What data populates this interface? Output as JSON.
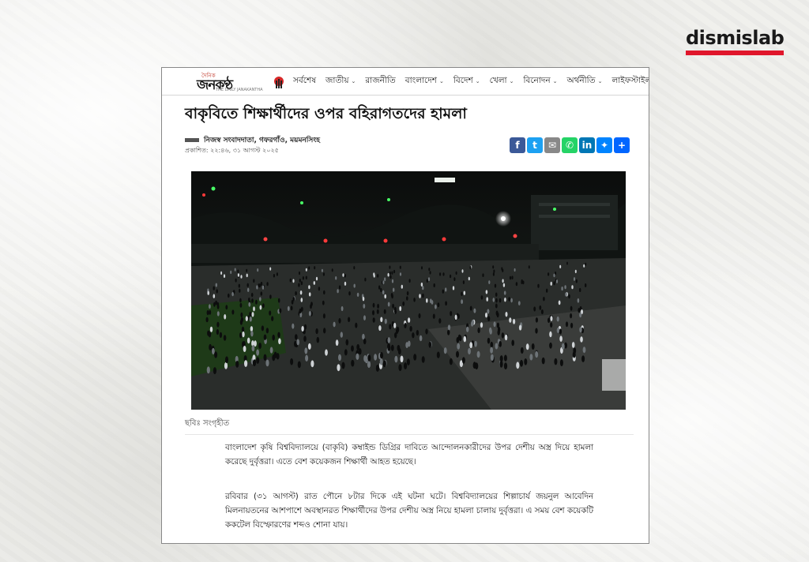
{
  "watermark": {
    "brand": "dismislab",
    "accent_color": "#e0162b"
  },
  "site": {
    "logo": {
      "small": "দৈনিক",
      "main": "জনকণ্ঠ",
      "sub": "THE DAILY JANAKANTHA"
    },
    "nav": [
      {
        "label": "সর্বশেষ",
        "has_dropdown": false
      },
      {
        "label": "জাতীয়",
        "has_dropdown": true
      },
      {
        "label": "রাজনীতি",
        "has_dropdown": false
      },
      {
        "label": "বাংলাদেশ",
        "has_dropdown": true
      },
      {
        "label": "বিদেশ",
        "has_dropdown": true
      },
      {
        "label": "খেলা",
        "has_dropdown": true
      },
      {
        "label": "বিনোদন",
        "has_dropdown": true
      },
      {
        "label": "অর্থনীতি",
        "has_dropdown": true
      },
      {
        "label": "লাইফস্টাইল",
        "has_dropdown": false
      }
    ]
  },
  "article": {
    "headline": "বাকৃবিতে শিক্ষার্থীদের ওপর বহিরাগতদের হামলা",
    "byline": "নিজস্ব সংবাদদাতা, গফরগাঁও, ময়মনসিংহ",
    "published": "প্রকাশিত: ২২:৪৬, ৩১ আগস্ট ২০২৫",
    "share_buttons": [
      {
        "icon": "facebook-icon",
        "glyph": "f",
        "color": "#3b5998"
      },
      {
        "icon": "twitter-icon",
        "glyph": "t",
        "color": "#1da1f2"
      },
      {
        "icon": "email-icon",
        "glyph": "✉",
        "color": "#888888"
      },
      {
        "icon": "whatsapp-icon",
        "glyph": "✆",
        "color": "#25d366"
      },
      {
        "icon": "linkedin-icon",
        "glyph": "in",
        "color": "#0077b5"
      },
      {
        "icon": "messenger-icon",
        "glyph": "✦",
        "color": "#0084ff"
      },
      {
        "icon": "share-plus-icon",
        "glyph": "+",
        "color": "#0166ff"
      }
    ],
    "caption": "ছবিঃ সংগৃহীত",
    "paragraphs": [
      "বাংলাদেশ কৃষি বিশ্ববিদ্যালয়ে (বাকৃবি) কম্বাইন্ড ডিগ্রির দাবিতে আন্দোলনকারীদের উপর দেশীয় অস্ত্র দিয়ে হামলা করেছে দুর্বৃত্তরা। এতে বেশ কয়েকজন শিক্ষার্থী আহত হয়েছে।",
      "রবিবার (৩১ আগস্ট) রাত পৌনে ৮টার দিকে এই ঘটনা ঘটে। বিশ্ববিদ্যালয়ের শিল্পাচার্য জয়নুল আবেদিন মিলনায়তনের আশপাশে অবস্থানরত শিক্ষার্থীদের উপর দেশীয় অস্ত্র নিয়ে হামলা চালায় দুর্বৃত্তরা। এ সময় বেশ কয়েকটি ককটেল বিস্ফোরণের শব্দও শোনা যায়।"
    ]
  }
}
